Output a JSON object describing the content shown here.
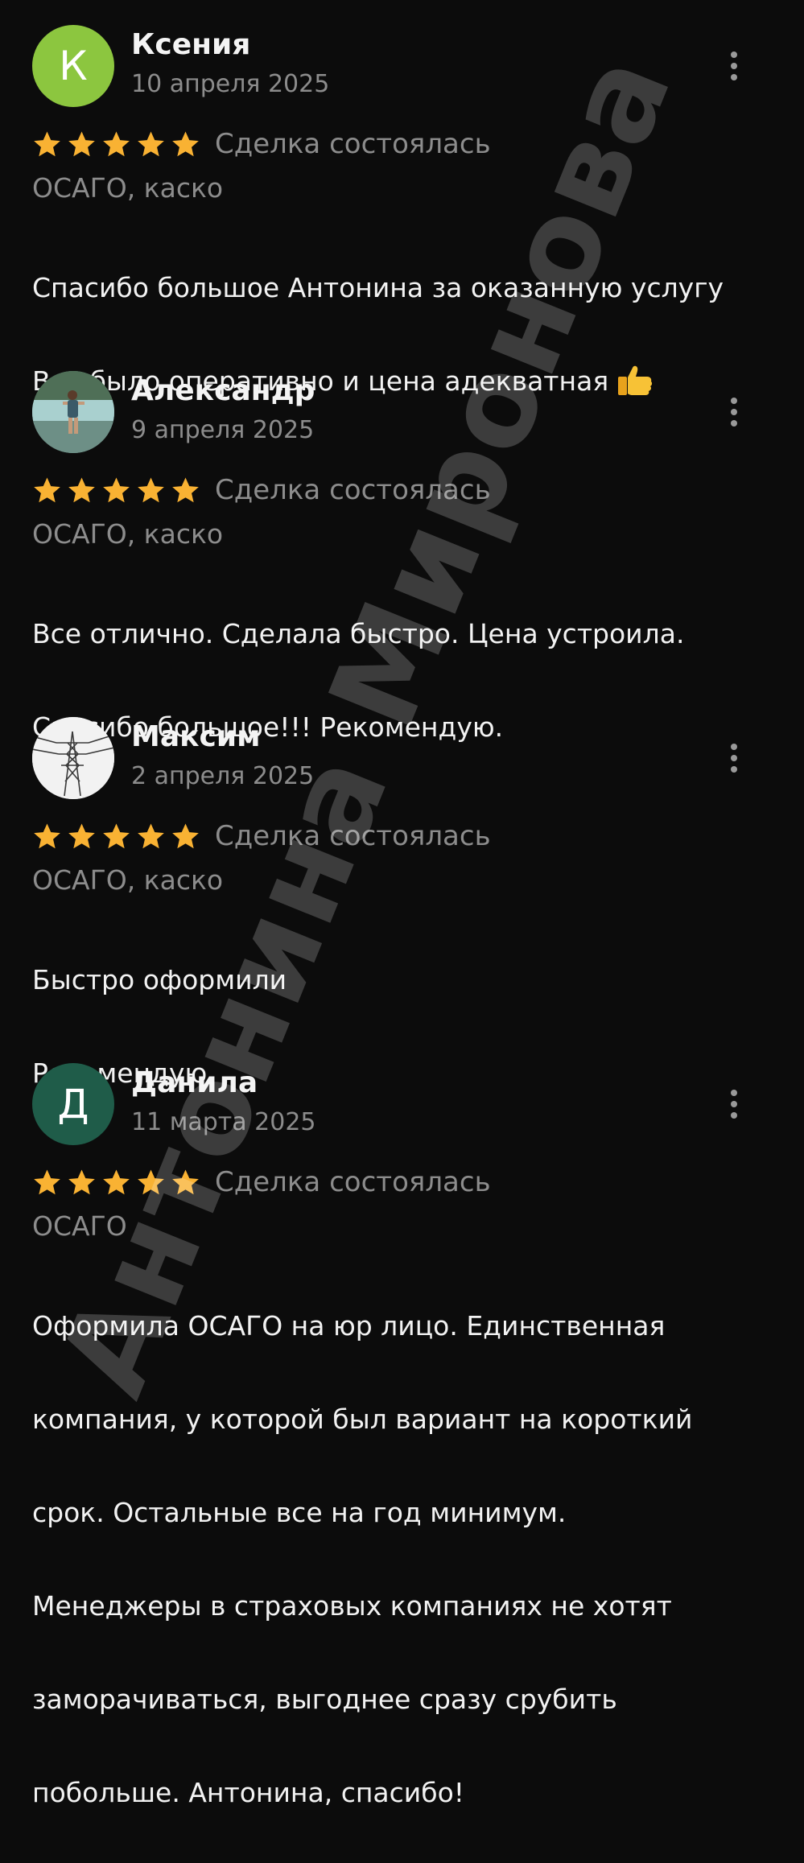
{
  "reviews": [
    {
      "name": "Ксения",
      "date": "10 апреля 2025",
      "avatar": {
        "type": "letter",
        "letter": "К",
        "color": "#8cc63f"
      },
      "rating": 5,
      "status": "Сделка состоялась",
      "category": "ОСАГО, каско",
      "text_lines": [
        "Спасибо большое Антонина за оказанную услугу",
        "Все было оперативно и цена адекватная"
      ],
      "emoji": "thumbs-up"
    },
    {
      "name": "Александр",
      "date": "9 апреля 2025",
      "avatar": {
        "type": "photo",
        "subject": "man-in-river-photo"
      },
      "rating": 5,
      "status": "Сделка состоялась",
      "category": "ОСАГО, каско",
      "text_lines": [
        "Все отлично.  Сделала быстро. Цена устроила.",
        "Спасибо  большое!!! Рекомендую."
      ]
    },
    {
      "name": "Максим",
      "date": "2 апреля 2025",
      "avatar": {
        "type": "photo",
        "subject": "power-tower-photo"
      },
      "rating": 5,
      "status": "Сделка состоялась",
      "category": "ОСАГО, каско",
      "text_lines": [
        "Быстро оформили",
        "Рекомендую"
      ]
    },
    {
      "name": "Данила",
      "date": "11 марта 2025",
      "avatar": {
        "type": "letter",
        "letter": "Д",
        "color": "#1f5c49"
      },
      "rating": 5,
      "status": "Сделка состоялась",
      "category": "ОСАГО",
      "text_lines": [
        "Оформила ОСАГО на юр лицо. Единственная",
        "компания, у которой был вариант на  короткий",
        "срок. Остальные все на год минимум.",
        "Менеджеры в страховых компаниях не хотят",
        "заморачиваться, выгоднее сразу срубить",
        "побольше. Антонина, спасибо!"
      ]
    }
  ],
  "watermark": "Антонина Миронова",
  "colors": {
    "background": "#0c0c0c",
    "star": "#f9b233",
    "muted_text": "#8c8c8c"
  }
}
